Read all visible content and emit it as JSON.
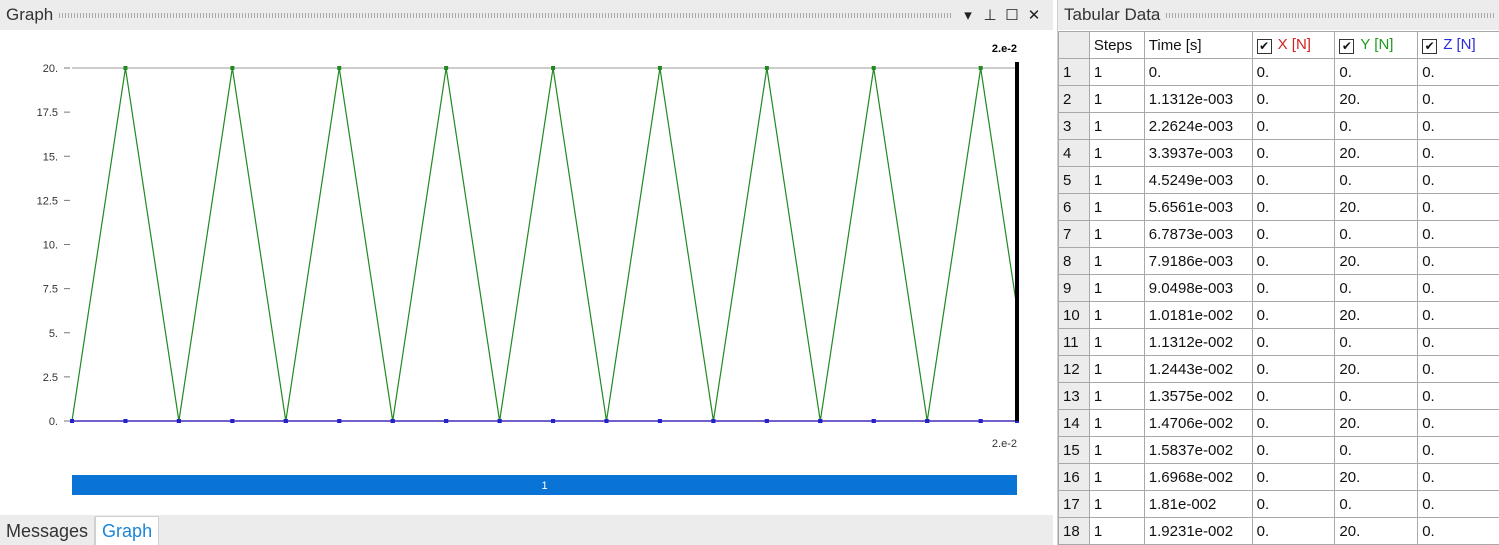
{
  "graph_pane": {
    "title": "Graph",
    "buttons": {
      "menu": "▾",
      "pin": "⊥",
      "maximize": "☐",
      "close": "✕"
    },
    "top_marker_label": "2.e-2",
    "bottom_marker_label": "2.e-2",
    "step_bar_label": "1",
    "step_bar_color": "#0a74d6"
  },
  "bottom_tabs": [
    {
      "label": "Messages",
      "active": false
    },
    {
      "label": "Graph",
      "active": true
    }
  ],
  "table_pane": {
    "title": "Tabular Data",
    "headers": {
      "steps": "Steps",
      "time": "Time [s]",
      "x": "X [N]",
      "y": "Y [N]",
      "z": "Z [N]"
    },
    "checkbox_glyph": "✔",
    "header_colors": {
      "x": "#d42020",
      "y": "#1f9a1f",
      "z": "#2a2ad8"
    },
    "rows": [
      {
        "n": "1",
        "step": "1",
        "time": "0.",
        "x": "0.",
        "y": "0.",
        "z": "0."
      },
      {
        "n": "2",
        "step": "1",
        "time": "1.1312e-003",
        "x": "0.",
        "y": "20.",
        "z": "0."
      },
      {
        "n": "3",
        "step": "1",
        "time": "2.2624e-003",
        "x": "0.",
        "y": "0.",
        "z": "0."
      },
      {
        "n": "4",
        "step": "1",
        "time": "3.3937e-003",
        "x": "0.",
        "y": "20.",
        "z": "0."
      },
      {
        "n": "5",
        "step": "1",
        "time": "4.5249e-003",
        "x": "0.",
        "y": "0.",
        "z": "0."
      },
      {
        "n": "6",
        "step": "1",
        "time": "5.6561e-003",
        "x": "0.",
        "y": "20.",
        "z": "0."
      },
      {
        "n": "7",
        "step": "1",
        "time": "6.7873e-003",
        "x": "0.",
        "y": "0.",
        "z": "0."
      },
      {
        "n": "8",
        "step": "1",
        "time": "7.9186e-003",
        "x": "0.",
        "y": "20.",
        "z": "0."
      },
      {
        "n": "9",
        "step": "1",
        "time": "9.0498e-003",
        "x": "0.",
        "y": "0.",
        "z": "0."
      },
      {
        "n": "10",
        "step": "1",
        "time": "1.0181e-002",
        "x": "0.",
        "y": "20.",
        "z": "0."
      },
      {
        "n": "11",
        "step": "1",
        "time": "1.1312e-002",
        "x": "0.",
        "y": "0.",
        "z": "0."
      },
      {
        "n": "12",
        "step": "1",
        "time": "1.2443e-002",
        "x": "0.",
        "y": "20.",
        "z": "0."
      },
      {
        "n": "13",
        "step": "1",
        "time": "1.3575e-002",
        "x": "0.",
        "y": "0.",
        "z": "0."
      },
      {
        "n": "14",
        "step": "1",
        "time": "1.4706e-002",
        "x": "0.",
        "y": "20.",
        "z": "0."
      },
      {
        "n": "15",
        "step": "1",
        "time": "1.5837e-002",
        "x": "0.",
        "y": "0.",
        "z": "0."
      },
      {
        "n": "16",
        "step": "1",
        "time": "1.6968e-002",
        "x": "0.",
        "y": "20.",
        "z": "0."
      },
      {
        "n": "17",
        "step": "1",
        "time": "1.81e-002",
        "x": "0.",
        "y": "0.",
        "z": "0."
      },
      {
        "n": "18",
        "step": "1",
        "time": "1.9231e-002",
        "x": "0.",
        "y": "20.",
        "z": "0."
      }
    ]
  },
  "chart_data": {
    "type": "line",
    "title": "",
    "xlabel": "",
    "ylabel": "",
    "xlim": [
      0,
      0.02
    ],
    "ylim": [
      0,
      20
    ],
    "y_ticks": [
      "0.",
      "2.5",
      "5.",
      "7.5",
      "10.",
      "12.5",
      "15.",
      "17.5",
      "20."
    ],
    "y_tick_values": [
      0,
      2.5,
      5,
      7.5,
      10,
      12.5,
      15,
      17.5,
      20
    ],
    "grid": false,
    "x": [
      0,
      0.0011312,
      0.0022624,
      0.0033937,
      0.0045249,
      0.0056561,
      0.0067873,
      0.0079186,
      0.0090498,
      0.010181,
      0.011312,
      0.012443,
      0.013575,
      0.014706,
      0.015837,
      0.016968,
      0.0181,
      0.019231,
      0.02
    ],
    "series": [
      {
        "color": "#d42020",
        "values": [
          0,
          0,
          0,
          0,
          0,
          0,
          0,
          0,
          0,
          0,
          0,
          0,
          0,
          0,
          0,
          0,
          0,
          0,
          0
        ]
      },
      {
        "color": "#1f8a1f",
        "values": [
          0,
          20,
          0,
          20,
          0,
          20,
          0,
          20,
          0,
          20,
          0,
          20,
          0,
          20,
          0,
          20,
          0,
          20,
          6.4
        ]
      },
      {
        "color": "#2222cc",
        "values": [
          0,
          0,
          0,
          0,
          0,
          0,
          0,
          0,
          0,
          0,
          0,
          0,
          0,
          0,
          0,
          0,
          0,
          0,
          0
        ]
      }
    ],
    "cursor_x": 0.02
  }
}
